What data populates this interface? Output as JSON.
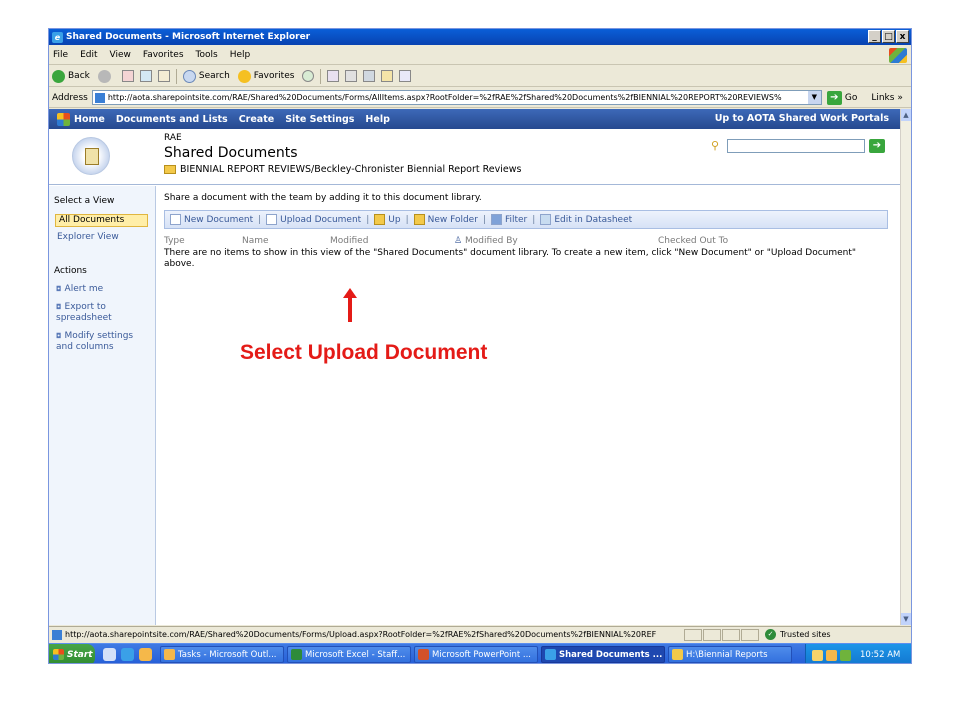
{
  "window": {
    "title": "Shared Documents - Microsoft Internet Explorer",
    "controls": [
      "_",
      "□",
      "x"
    ]
  },
  "menu": [
    "File",
    "Edit",
    "View",
    "Favorites",
    "Tools",
    "Help"
  ],
  "toolbar": {
    "back": "Back",
    "search": "Search",
    "favorites": "Favorites"
  },
  "address": {
    "label": "Address",
    "url": "http://aota.sharepointsite.com/RAE/Shared%20Documents/Forms/AllItems.aspx?RootFolder=%2fRAE%2fShared%20Documents%2fBIENNIAL%20REPORT%20REVIEWS%",
    "go": "Go",
    "links": "Links"
  },
  "spnav": {
    "items": [
      "Home",
      "Documents and Lists",
      "Create",
      "Site Settings",
      "Help"
    ],
    "right_link": "Up to AOTA Shared Work Portals"
  },
  "header": {
    "site_name": "RAE",
    "page_title": "Shared Documents",
    "breadcrumb": "BIENNIAL REPORT REVIEWS/Beckley-Chronister Biennial Report Reviews"
  },
  "leftnav": {
    "select_view": "Select a View",
    "views": [
      "All Documents",
      "Explorer View"
    ],
    "actions_title": "Actions",
    "actions": [
      "Alert me",
      "Export to spreadsheet",
      "Modify settings and columns"
    ]
  },
  "main": {
    "description": "Share a document with the team by adding it to this document library.",
    "actions": [
      "New Document",
      "Upload Document",
      "Up",
      "New Folder",
      "Filter",
      "Edit in Datasheet"
    ],
    "columns": [
      "Type",
      "Name",
      "Modified",
      "Modified By",
      "Checked Out To"
    ],
    "empty_message": "There are no items to show in this view of the \"Shared Documents\" document library. To create a new item, click \"New Document\" or \"Upload Document\" above."
  },
  "status": {
    "url": "http://aota.sharepointsite.com/RAE/Shared%20Documents/Forms/Upload.aspx?RootFolder=%2fRAE%2fShared%20Documents%2fBIENNIAL%20REF",
    "zone": "Trusted sites"
  },
  "taskbar": {
    "start": "Start",
    "tasks": [
      "Tasks - Microsoft Outl...",
      "Microsoft Excel - Staff...",
      "Microsoft PowerPoint ...",
      "Shared Documents ...",
      "H:\\Biennial Reports"
    ],
    "clock": "10:52 AM"
  },
  "annotation": {
    "label": "Select Upload Document",
    "color": "#e41b17"
  }
}
